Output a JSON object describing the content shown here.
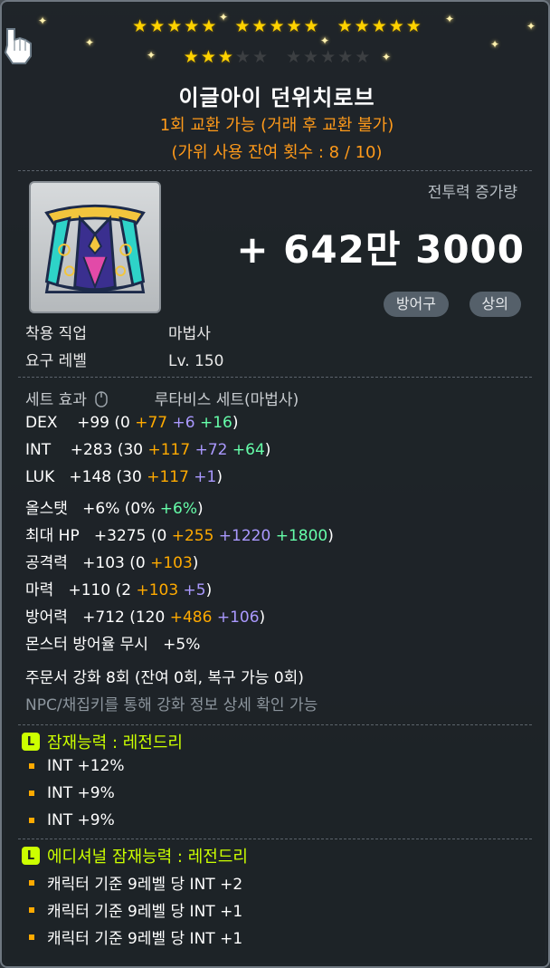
{
  "stars": {
    "filled": 18,
    "total": 25
  },
  "item": {
    "name": "이글아이 던위치로브",
    "trade_note": "1회 교환 가능 (거래 후 교환 불가)",
    "scissors_note": "(가위 사용 잔여 횟수 : 8 / 10)"
  },
  "combat_power": {
    "label": "전투력 증가량",
    "value": "+ 642만 3000"
  },
  "tags": [
    "방어구",
    "상의"
  ],
  "requirements": [
    {
      "key": "착용 직업",
      "value": "마법사"
    },
    {
      "key": "요구 레벨",
      "value": "Lv. 150"
    }
  ],
  "set_effect": {
    "label": "세트 효과",
    "value": "루타비스 세트(마법사)"
  },
  "stats": [
    [
      {
        "t": "DEX    +99 (0 ",
        "c": "base"
      },
      {
        "t": "+77",
        "c": "orange"
      },
      {
        "t": " +6",
        "c": "purple"
      },
      {
        "t": " +16",
        "c": "green"
      },
      {
        "t": ")",
        "c": "base"
      }
    ],
    [
      {
        "t": "INT    +283 (30 ",
        "c": "base"
      },
      {
        "t": "+117",
        "c": "orange"
      },
      {
        "t": " +72",
        "c": "purple"
      },
      {
        "t": " +64",
        "c": "green"
      },
      {
        "t": ")",
        "c": "base"
      }
    ],
    [
      {
        "t": "LUK   +148 (30 ",
        "c": "base"
      },
      {
        "t": "+117",
        "c": "orange"
      },
      {
        "t": " +1",
        "c": "purple"
      },
      {
        "t": ")",
        "c": "base"
      }
    ],
    [
      {
        "t": "올스탯   +6% (0% ",
        "c": "base"
      },
      {
        "t": "+6%",
        "c": "green"
      },
      {
        "t": ")",
        "c": "base"
      }
    ],
    [
      {
        "t": "최대 HP   +3275 (0 ",
        "c": "base"
      },
      {
        "t": "+255",
        "c": "orange"
      },
      {
        "t": " +1220",
        "c": "purple"
      },
      {
        "t": " +1800",
        "c": "green"
      },
      {
        "t": ")",
        "c": "base"
      }
    ],
    [
      {
        "t": "공격력   +103 (0 ",
        "c": "base"
      },
      {
        "t": "+103",
        "c": "orange"
      },
      {
        "t": ")",
        "c": "base"
      }
    ],
    [
      {
        "t": "마력   +110 (2 ",
        "c": "base"
      },
      {
        "t": "+103",
        "c": "orange"
      },
      {
        "t": " +5",
        "c": "purple"
      },
      {
        "t": ")",
        "c": "base"
      }
    ],
    [
      {
        "t": "방어력   +712 (120 ",
        "c": "base"
      },
      {
        "t": "+486",
        "c": "orange"
      },
      {
        "t": " +106",
        "c": "purple"
      },
      {
        "t": ")",
        "c": "base"
      }
    ],
    [
      {
        "t": "몬스터 방어율 무시   +5%",
        "c": "base"
      }
    ]
  ],
  "scroll_note": "주문서 강화 8회 (잔여 0회, 복구 가능 0회)",
  "npc_note": "NPC/채집키를 통해 강화 정보 상세 확인 가능",
  "potential": {
    "badge": "L",
    "title": "잠재능력 : 레전드리",
    "lines": [
      "INT +12%",
      "INT +9%",
      "INT +9%"
    ]
  },
  "additional_potential": {
    "badge": "L",
    "title": "에디셔널 잠재능력 : 레전드리",
    "lines": [
      "캐릭터 기준 9레벨 당 INT +2",
      "캐릭터 기준 9레벨 당 INT +1",
      "캐릭터 기준 9레벨 당 INT +1"
    ]
  },
  "colors": {
    "gold_star": "#ffd200",
    "orange": "#ffaa00",
    "purple": "#aa99ff",
    "green": "#66ffaa",
    "legendary": "#ccff00",
    "trade": "#ff9a1a"
  }
}
